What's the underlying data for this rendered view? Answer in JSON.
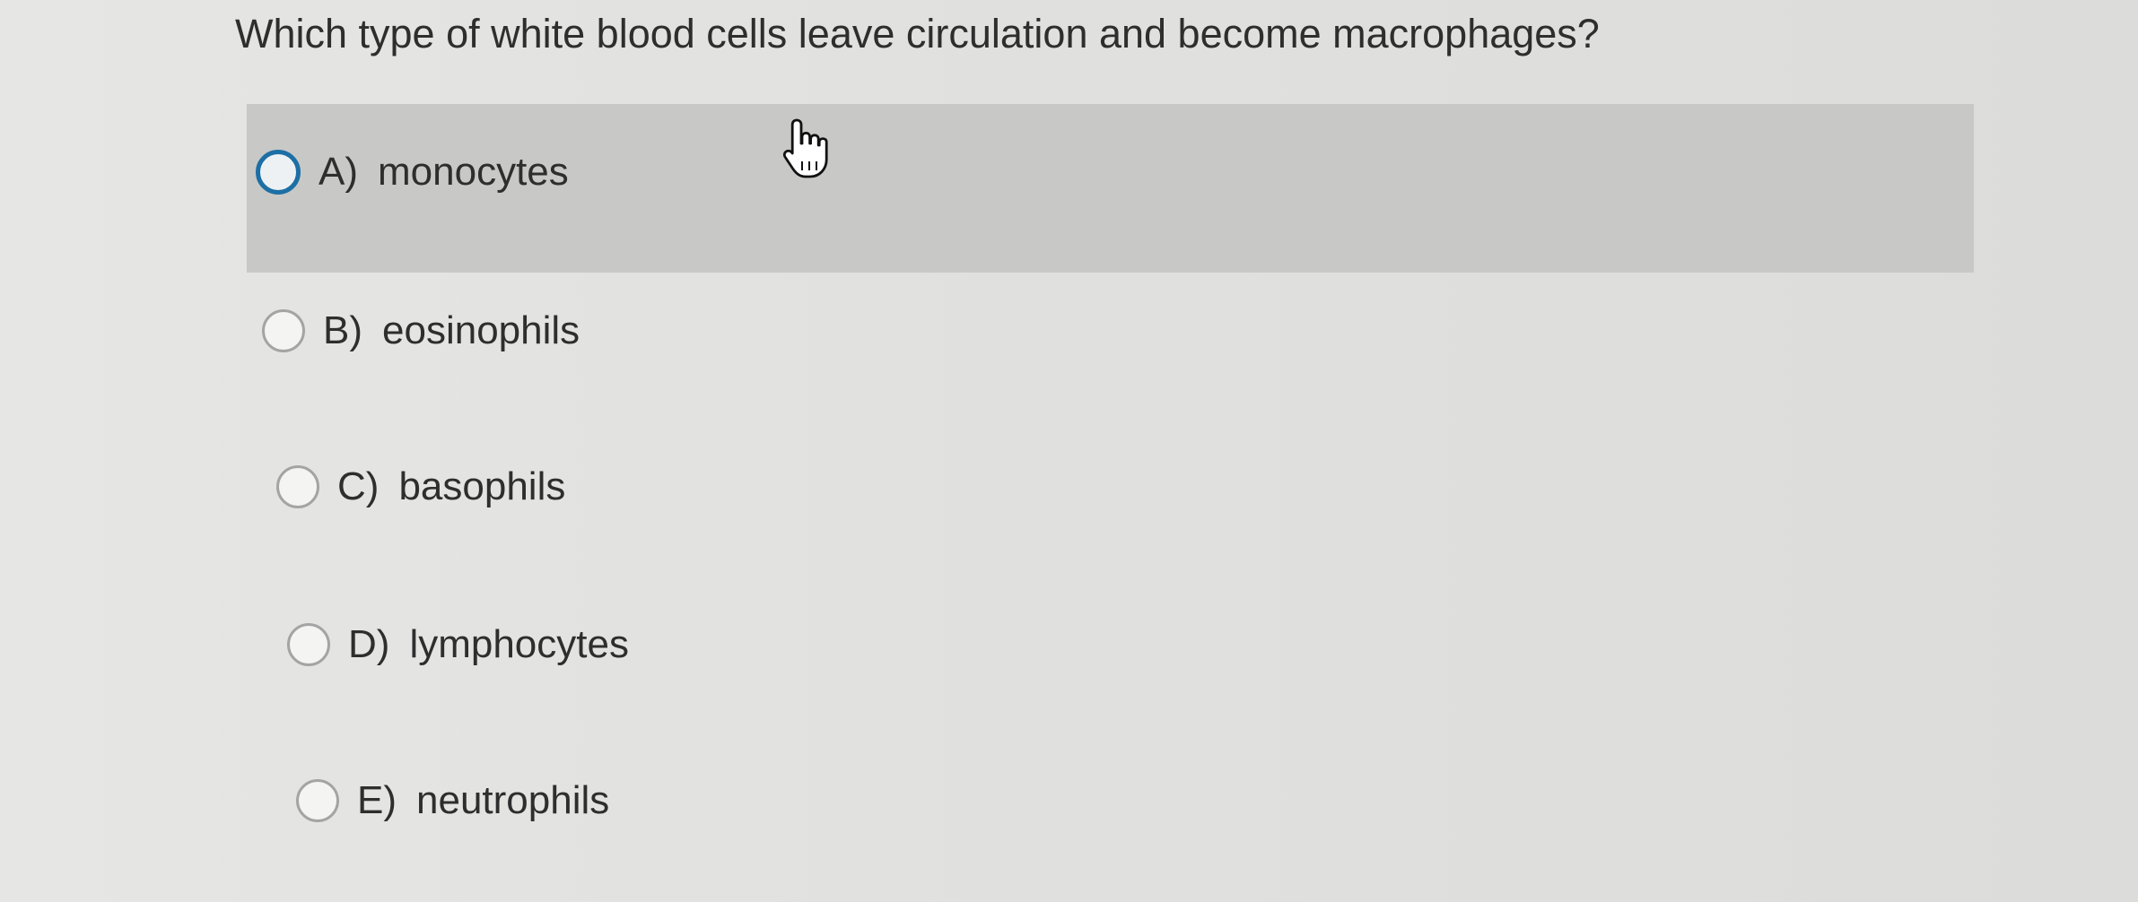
{
  "question": "Which type of white blood cells leave circulation and become macrophages?",
  "options": [
    {
      "letter": "A)",
      "text": "monocytes",
      "hovered": true
    },
    {
      "letter": "B)",
      "text": "eosinophils",
      "hovered": false
    },
    {
      "letter": "C)",
      "text": "basophils",
      "hovered": false
    },
    {
      "letter": "D)",
      "text": "lymphocytes",
      "hovered": false
    },
    {
      "letter": "E)",
      "text": "neutrophils",
      "hovered": false
    }
  ],
  "colors": {
    "background": "#e3e3e1",
    "hover_row": "#c8c8c6",
    "radio_hover_border": "#1d6fa5",
    "radio_border": "#a4a4a4",
    "text": "#2e2e2e"
  },
  "cursor_icon": "hand-pointer-icon"
}
